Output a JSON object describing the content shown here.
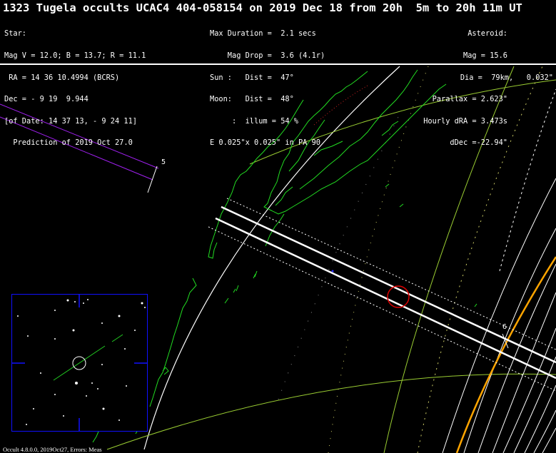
{
  "header": {
    "title": "1323 Tugela occults UCAC4 404-058154 on 2019 Dec 18 from 20h  5m to 20h 11m UT"
  },
  "star": {
    "heading": "Star:",
    "mags": "Mag V = 12.0; B = 13.7; R = 11.1",
    "ra": " RA = 14 36 10.4994 (BCRS)",
    "dec": "Dec = - 9 19  9.944",
    "of_date": "[of Date: 14 37 13, - 9 24 11]",
    "prediction": "  Prediction of 2019 Oct 27.0"
  },
  "event": {
    "max_duration": "Max Duration =  2.1 secs",
    "mag_drop": "    Mag Drop =  3.6 (4.1r)",
    "sun": "Sun :   Dist =  47°",
    "moon": "Moon:   Dist =  48°",
    "illum": "     :  illum = 54 %",
    "ellipse": "E 0.025\"x 0.025\" in PA 90"
  },
  "asteroid": {
    "heading": "Asteroid:",
    "mag": "Mag = 15.6",
    "dia": "Dia =  79km,   0.032\"",
    "parallax": "Parallax = 2.623\"",
    "hourly_dra": "Hourly dRA = 3.473s",
    "ddec": "dDec =-22.94\""
  },
  "footer": {
    "text": "Occult 4.8.0.0, 2019Oct27, Errors: Meas"
  },
  "map": {
    "tick_labels": [
      "5",
      "6"
    ],
    "colors": {
      "background": "#000000",
      "path": "#ffffff",
      "coastline": "#22dd22",
      "grid": "#9acd32",
      "limb_yellow": "#ffa500",
      "track_purple": "#a020f0",
      "red_marker": "#e00000",
      "inset_border": "#1010ff"
    }
  }
}
